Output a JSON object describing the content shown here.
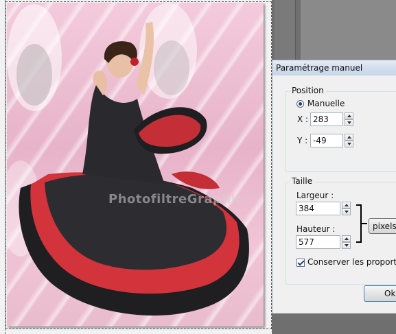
{
  "watermark": "PhotofiltreGraphic",
  "dialog": {
    "title": "Paramétrage manuel",
    "position": {
      "legend": "Position",
      "mode_label": "Manuelle",
      "mode_selected": true,
      "x_label": "X :",
      "x_value": "283",
      "y_label": "Y :",
      "y_value": "-49"
    },
    "taille": {
      "legend": "Taille",
      "width_label": "Largeur :",
      "width_value": "384",
      "height_label": "Hauteur :",
      "height_value": "577",
      "units": "pixels",
      "keep_ratio_label": "Conserver les proportions",
      "keep_ratio_checked": true
    },
    "ok_label": "Ok"
  },
  "colors": {
    "dress": "#2a2a2e",
    "ruffle": "#d3343c",
    "background_pink": "#eec0d3",
    "dialog_bg": "#f0f0f0"
  }
}
